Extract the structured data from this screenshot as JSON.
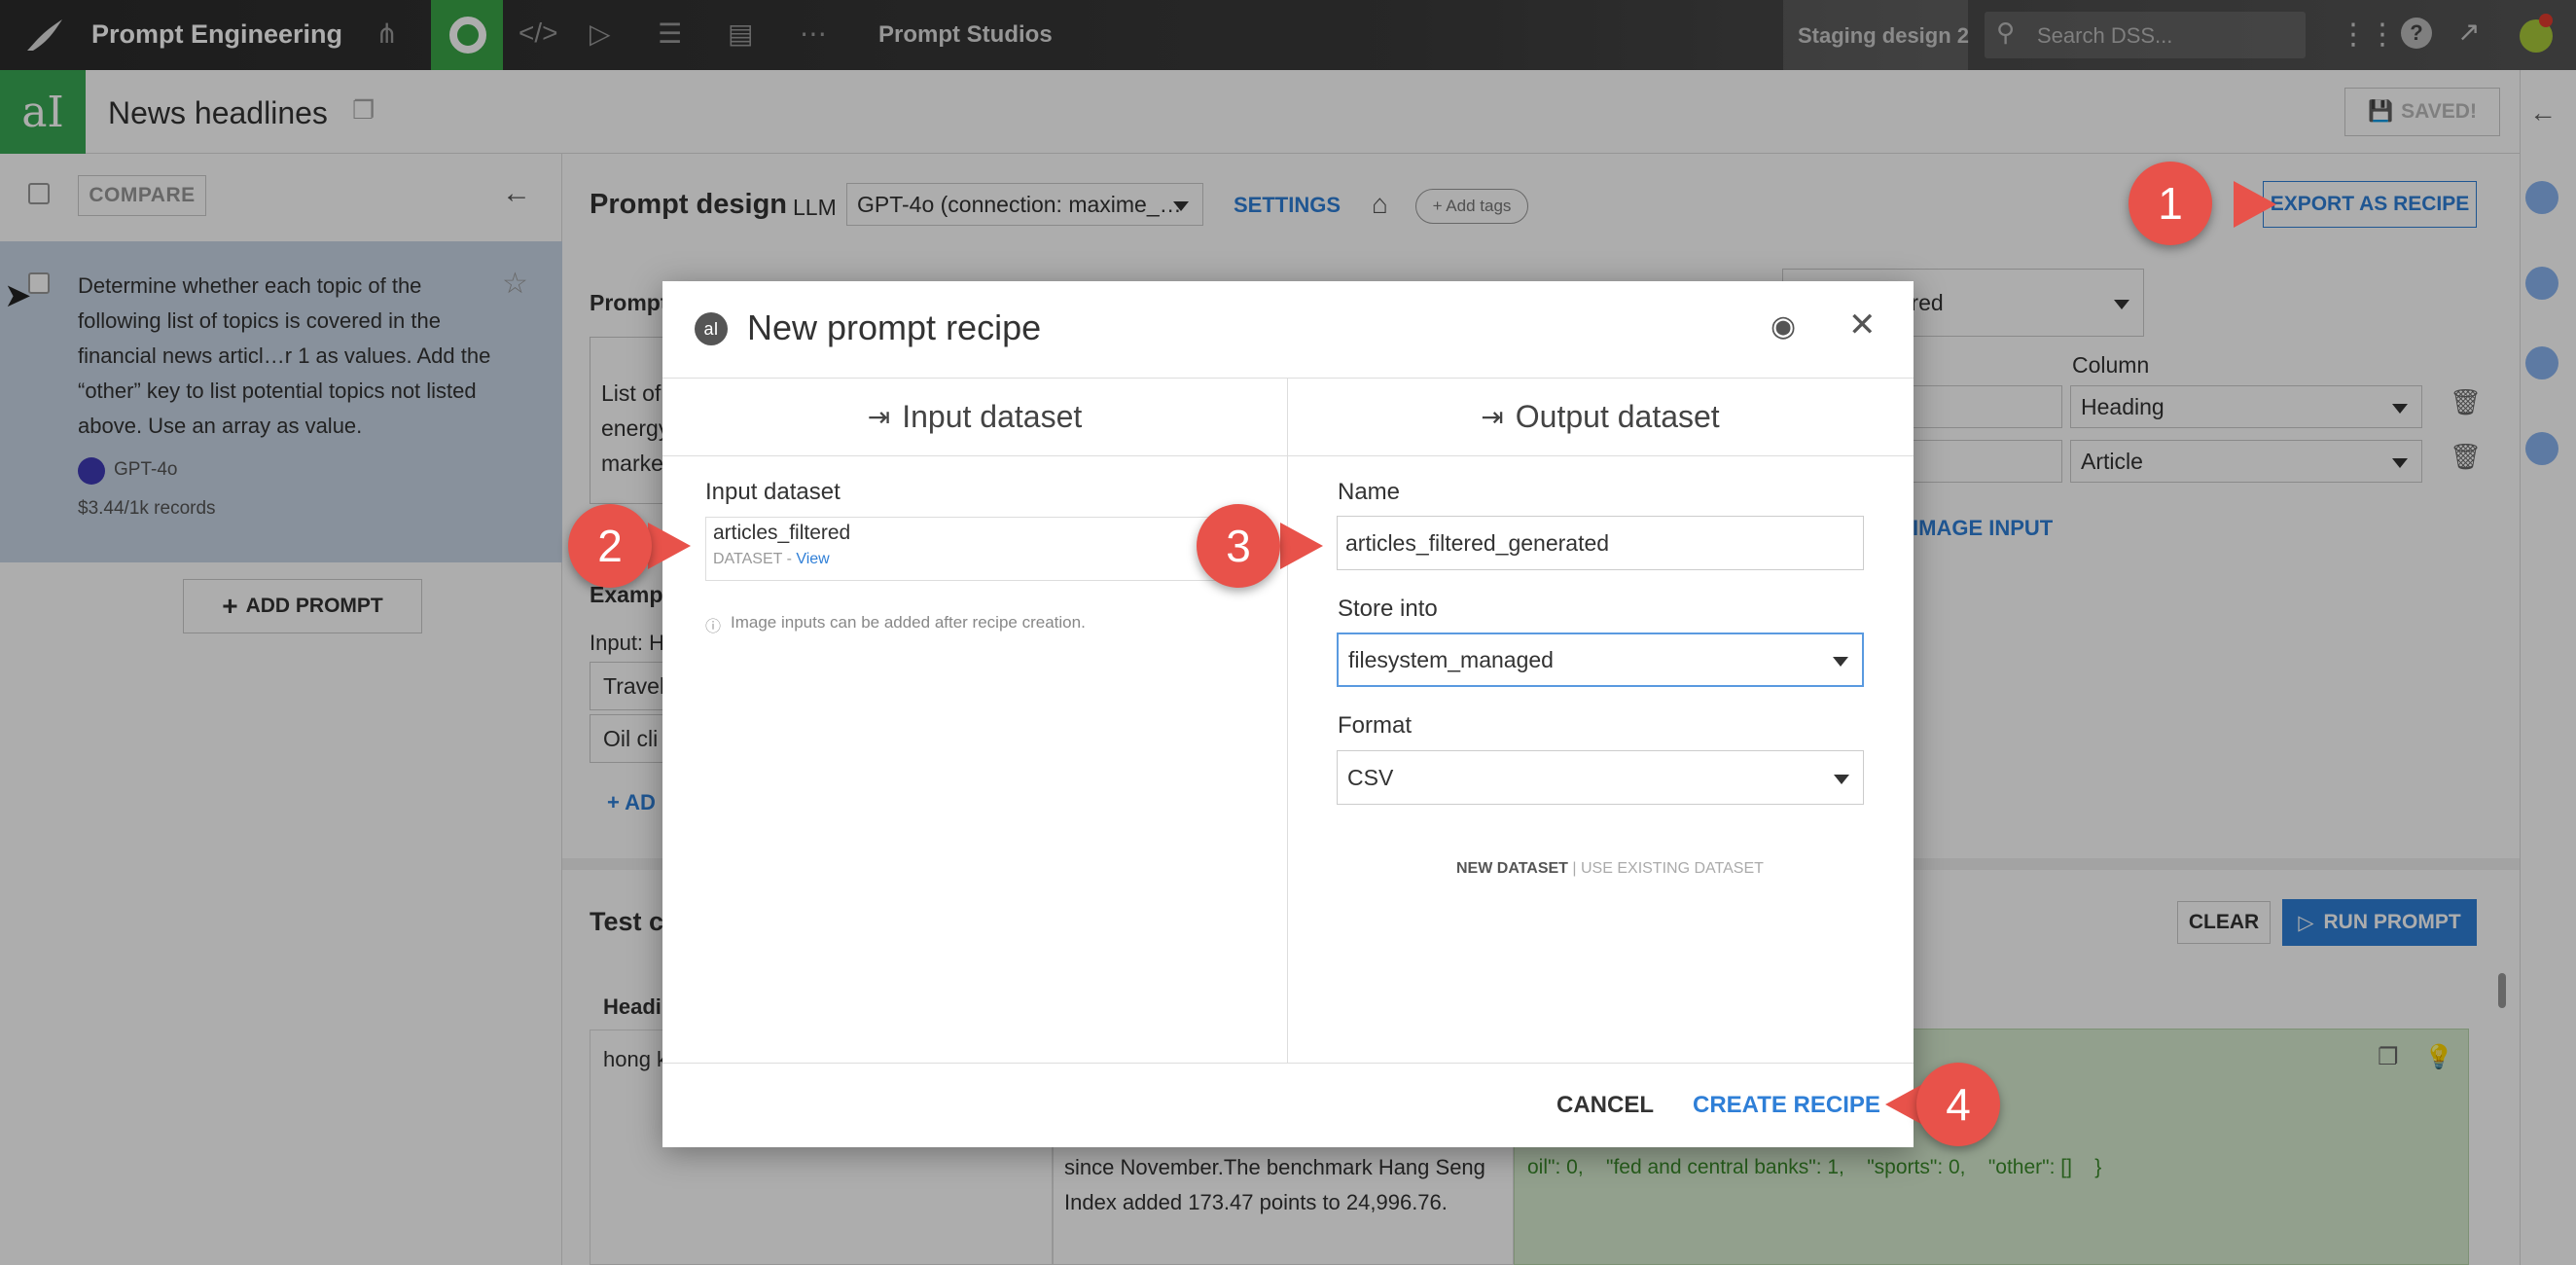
{
  "nav": {
    "app_title": "Prompt Engineering",
    "section_title": "Prompt Studios",
    "design_label": "Staging design 2",
    "search_placeholder": "Search DSS..."
  },
  "header": {
    "title": "News headlines",
    "saved_label": "SAVED!"
  },
  "sidebar": {
    "compare_label": "COMPARE",
    "prompt_text": "Determine whether each topic of the following list of topics is covered in the financial news articl…r 1 as values. Add the “other” key to list potential topics not listed above. Use an array as value.",
    "model_label": "GPT-4o",
    "cost_label": "$3.44/1k records",
    "add_prompt_label": "ADD PROMPT"
  },
  "main": {
    "prompt_design_label": "Prompt design",
    "llm_label": "LLM",
    "llm_value": "GPT-4o (connection: maxime_…",
    "settings_label": "SETTINGS",
    "add_tags_label": "+ Add tags",
    "export_label": "EXPORT AS RECIPE",
    "prompt_section": "Prompt",
    "dataset_select": "articles_filtered",
    "column_header": "Column",
    "column_1": "Heading",
    "column_2": "Article",
    "image_input_label": "IMAGE INPUT",
    "prompt_fragment": "List of\nenergy\nmarke",
    "examples_label": "Exampl",
    "input_label": "Input: H",
    "example_1": "Travel",
    "example_2": "Oil cli",
    "add_label": "AD",
    "test_cases_label": "Test ca",
    "clear_label": "CLEAR",
    "run_prompt_label": "RUN PROMPT",
    "heading_col": "Headi",
    "row_heading": "hong k",
    "row_article": "weekend cut interest rates for the second time since November.The benchmark Hang Seng Index added 173.47 points to 24,996.76.",
    "result_text": "rporate debt and earnings\": 0,    \"IPO\": 0,\n\"markets\": 1,    \"legal and\ngold and metals\": 0,    \"energy and\noil\": 0,    \"fed and central banks\": 1,    \"sports\": 0,    \"other\": []    }"
  },
  "modal": {
    "title": "New prompt recipe",
    "input_tab": "Input dataset",
    "output_tab": "Output dataset",
    "input_dataset_label": "Input dataset",
    "input_dataset_name": "articles_filtered",
    "input_dataset_type": "DATASET",
    "view_link": "View",
    "image_note": "Image inputs can be added after recipe creation.",
    "name_label": "Name",
    "name_value": "articles_filtered_generated",
    "store_label": "Store into",
    "store_value": "filesystem_managed",
    "format_label": "Format",
    "format_value": "CSV",
    "new_dataset": "NEW DATASET",
    "use_existing": "USE EXISTING DATASET",
    "cancel_label": "CANCEL",
    "create_label": "CREATE RECIPE"
  },
  "badges": [
    "1",
    "2",
    "3",
    "4"
  ],
  "colors": {
    "accent_blue": "#2f7fd7",
    "brand_green": "#39a955",
    "badge_red": "#e8524a"
  }
}
